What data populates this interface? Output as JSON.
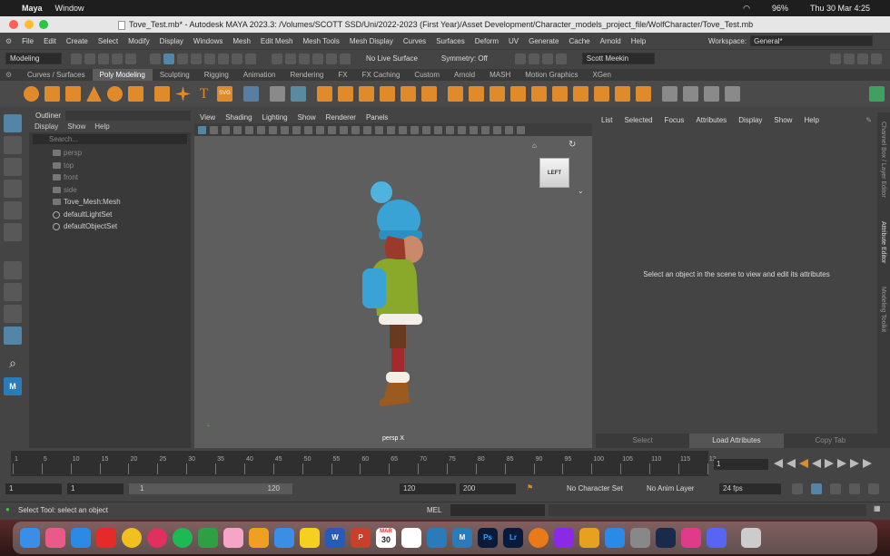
{
  "mac_menubar": {
    "app_name": "Maya",
    "menu": "Window",
    "battery": "96%",
    "clock": "Thu 30 Mar  4:25"
  },
  "window": {
    "title": "Tove_Test.mb* - Autodesk MAYA 2023.3: /Volumes/SCOTT SSD/Uni/2022-2023 (First Year)/Asset Development/Character_models_project_file/WolfCharacter/Tove_Test.mb"
  },
  "menus": [
    "File",
    "Edit",
    "Create",
    "Select",
    "Modify",
    "Display",
    "Windows",
    "Mesh",
    "Edit Mesh",
    "Mesh Tools",
    "Mesh Display",
    "Curves",
    "Surfaces",
    "Deform",
    "UV",
    "Generate",
    "Cache",
    "Arnold",
    "Help"
  ],
  "workspace": {
    "label": "Workspace:",
    "value": "General*"
  },
  "statusline": {
    "mode": "Modeling",
    "live_surface": "No Live Surface",
    "symmetry": "Symmetry: Off",
    "user": "Scott Meekin"
  },
  "shelf_tabs": [
    "Curves / Surfaces",
    "Poly Modeling",
    "Sculpting",
    "Rigging",
    "Animation",
    "Rendering",
    "FX",
    "FX Caching",
    "Custom",
    "Arnold",
    "MASH",
    "Motion Graphics",
    "XGen"
  ],
  "active_shelf_tab": "Poly Modeling",
  "outliner": {
    "title": "Outliner",
    "menu": [
      "Display",
      "Show",
      "Help"
    ],
    "search_placeholder": "Search...",
    "items": [
      {
        "label": "persp",
        "dim": true
      },
      {
        "label": "top",
        "dim": true
      },
      {
        "label": "front",
        "dim": true
      },
      {
        "label": "side",
        "dim": true
      },
      {
        "label": "Tove_Mesh:Mesh",
        "dim": false
      },
      {
        "label": "defaultLightSet",
        "dim": false
      },
      {
        "label": "defaultObjectSet",
        "dim": false
      }
    ]
  },
  "viewport": {
    "menu": [
      "View",
      "Shading",
      "Lighting",
      "Show",
      "Renderer",
      "Panels"
    ],
    "viewcube_label": "LEFT",
    "camera_label": "persp X"
  },
  "attribute_editor": {
    "menu": [
      "List",
      "Selected",
      "Focus",
      "Attributes",
      "Display",
      "Show",
      "Help"
    ],
    "message": "Select an object in the scene to view and edit its attributes",
    "buttons": [
      "Select",
      "Load Attributes",
      "Copy Tab"
    ],
    "side_tabs": [
      "Channel Box / Layer Editor",
      "Attribute Editor",
      "Modeling Toolkit"
    ]
  },
  "timeline": {
    "ticks": [
      "1",
      "5",
      "10",
      "15",
      "20",
      "25",
      "30",
      "35",
      "40",
      "45",
      "50",
      "55",
      "60",
      "65",
      "70",
      "75",
      "80",
      "85",
      "90",
      "95",
      "100",
      "105",
      "110",
      "115",
      "12"
    ],
    "current_frame": "1"
  },
  "range": {
    "start": "1",
    "inner_start": "1",
    "slider_start": "1",
    "slider_end": "120",
    "inner_end": "120",
    "end": "200",
    "character_set": "No Character Set",
    "anim_layer": "No Anim Layer",
    "fps": "24 fps"
  },
  "cmdline": {
    "help": "Select Tool: select an object",
    "lang": "MEL"
  },
  "dock": {
    "calendar_month": "MAR",
    "calendar_day": "30"
  },
  "colors": {
    "maya_accent": "#5285a6",
    "shelf_orange": "#e08a2a"
  }
}
